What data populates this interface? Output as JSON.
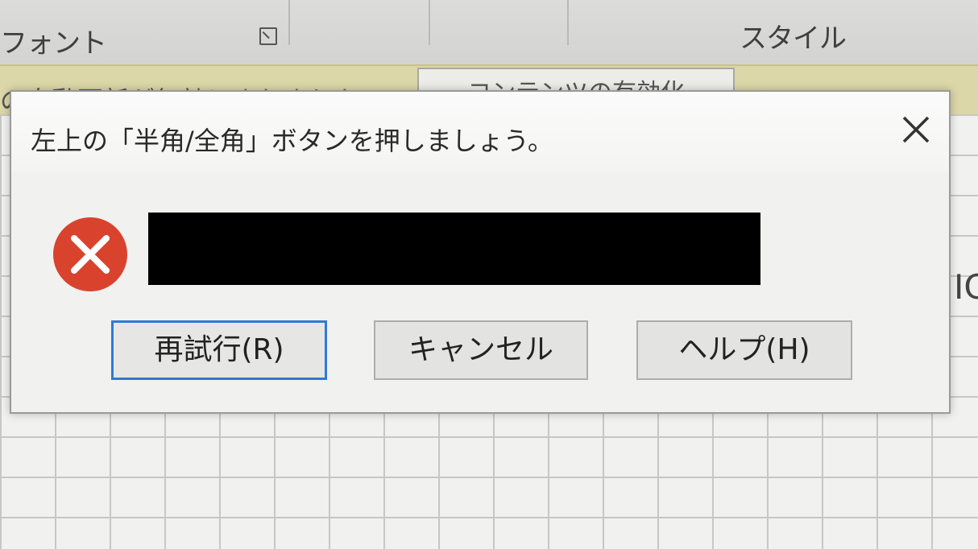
{
  "ribbon": {
    "font_group_label": "フォント",
    "style_group_label": "スタイル"
  },
  "message_bar": {
    "text": "の自動更新が無効にされました",
    "enable_button_label": "コンテンツの有効化"
  },
  "sheet": {
    "stray_text": "IC"
  },
  "dialog": {
    "title": "左上の「半角/全角」ボタンを押しましょう。",
    "icon": "error-icon",
    "message": "",
    "buttons": {
      "retry": "再試行(R)",
      "cancel": "キャンセル",
      "help": "ヘルプ(H)"
    }
  },
  "colors": {
    "error_red": "#d9432d",
    "focus_blue": "#2f7ad1",
    "message_bar_yellow": "#dcd7a8"
  }
}
